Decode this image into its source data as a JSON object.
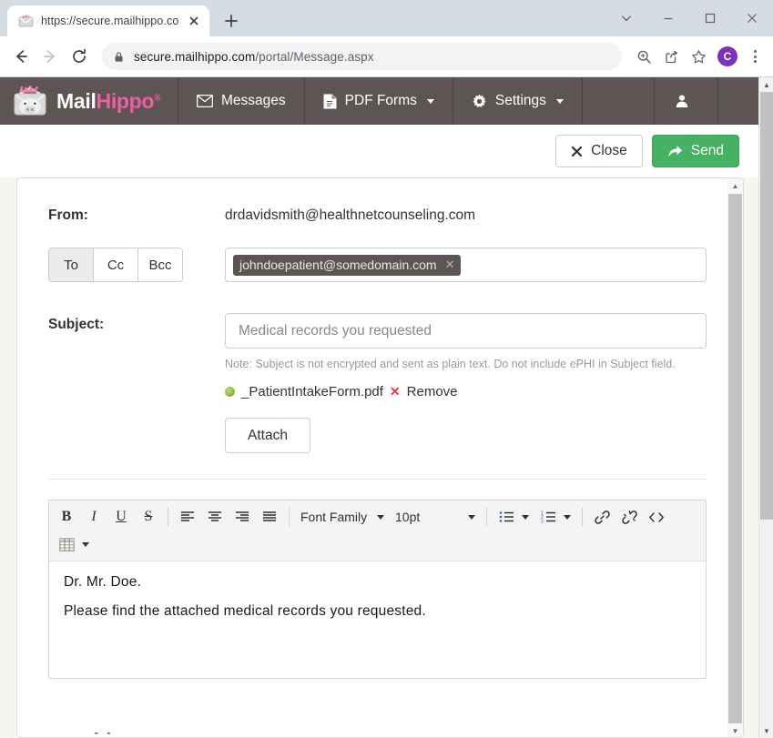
{
  "browser": {
    "tab": {
      "title": "https://secure.mailhippo.com/po",
      "favicon_icon": "mailhippo-favicon",
      "close_icon": "close-icon"
    },
    "new_tab_label": "+",
    "window_controls": [
      {
        "name": "tab-search-button",
        "icon": "chevron-down-icon"
      },
      {
        "name": "minimize-button",
        "icon": "minimize-icon"
      },
      {
        "name": "maximize-button",
        "icon": "maximize-icon"
      },
      {
        "name": "window-close-button",
        "icon": "close-icon"
      }
    ],
    "nav": {
      "back_icon": "arrow-left-icon",
      "forward_icon": "arrow-right-icon",
      "reload_icon": "reload-icon"
    },
    "omnibox": {
      "lock_icon": "lock-icon",
      "url_domain": "secure.mailhippo.com",
      "url_path": "/portal/Message.aspx"
    },
    "toolbar_icons": [
      {
        "name": "zoom-icon",
        "icon": "magnifier-icon"
      },
      {
        "name": "share-icon",
        "icon": "share-icon"
      },
      {
        "name": "bookmark-star-icon",
        "icon": "star-icon"
      }
    ],
    "profile": {
      "initial": "C",
      "color": "#7c33b5"
    },
    "menu_icon": "kebab-menu-icon"
  },
  "navbar": {
    "brand": {
      "mail": "Mail",
      "hippo": "Hippo",
      "registered": "®",
      "logo_icon": "mailhippo-logo"
    },
    "items": [
      {
        "label": "Messages",
        "icon": "envelope-icon",
        "caret": false
      },
      {
        "label": "PDF Forms",
        "icon": "pdf-file-icon",
        "caret": true
      },
      {
        "label": "Settings",
        "icon": "gear-icon",
        "caret": true
      }
    ],
    "user_menu": {
      "icon": "user-icon",
      "caret": true
    }
  },
  "actionbar": {
    "close_label": "Close",
    "close_icon": "x-icon",
    "send_label": "Send",
    "send_icon": "forward-arrow-icon",
    "send_color": "#46b063"
  },
  "compose": {
    "from_label": "From:",
    "from_value": "drdavidsmith@healthnetcounseling.com",
    "recipient_tabs": [
      {
        "label": "To",
        "active": true
      },
      {
        "label": "Cc",
        "active": false
      },
      {
        "label": "Bcc",
        "active": false
      }
    ],
    "recipients": [
      {
        "email": "johndoepatient@somedomain.com",
        "remove_icon": "chip-close-icon"
      }
    ],
    "subject_label": "Subject:",
    "subject_value": "Medical records you requested",
    "subject_placeholder": "Medical records you requested",
    "subject_note": "Note: Subject is not encrypted and sent as plain text. Do not include ePHI in Subject field.",
    "attachments": [
      {
        "name": "_PatientIntakeForm.pdf",
        "status_icon": "green-dot-icon",
        "remove_label": "Remove",
        "remove_icon": "red-x-icon"
      }
    ],
    "attach_button_label": "Attach"
  },
  "editor": {
    "toolbar_row1": [
      {
        "name": "bold-button",
        "glyph": "B",
        "title": "Bold"
      },
      {
        "name": "italic-button",
        "glyph": "I",
        "title": "Italic"
      },
      {
        "name": "underline-button",
        "glyph": "U",
        "title": "Underline"
      },
      {
        "name": "strikethrough-button",
        "glyph": "S",
        "title": "Strikethrough"
      },
      {
        "name": "align-left-button",
        "glyph": "align-left-icon",
        "title": "Align left"
      },
      {
        "name": "align-center-button",
        "glyph": "align-center-icon",
        "title": "Align center"
      },
      {
        "name": "align-right-button",
        "glyph": "align-right-icon",
        "title": "Align right"
      },
      {
        "name": "align-justify-button",
        "glyph": "align-justify-icon",
        "title": "Justify"
      }
    ],
    "font_family_label": "Font Family",
    "font_size_label": "10pt",
    "list_buttons": [
      {
        "name": "bullet-list-button",
        "icon": "bullet-list-icon"
      },
      {
        "name": "numbered-list-button",
        "icon": "numbered-list-icon"
      }
    ],
    "link_buttons": [
      {
        "name": "insert-link-button",
        "icon": "link-icon"
      },
      {
        "name": "unlink-button",
        "icon": "unlink-icon"
      },
      {
        "name": "source-code-button",
        "icon": "code-icon"
      }
    ],
    "table_button": {
      "name": "insert-table-button",
      "icon": "table-icon"
    },
    "body_lines": [
      "Dr. Mr. Doe.",
      "Please find the attached medical records you requested."
    ]
  }
}
